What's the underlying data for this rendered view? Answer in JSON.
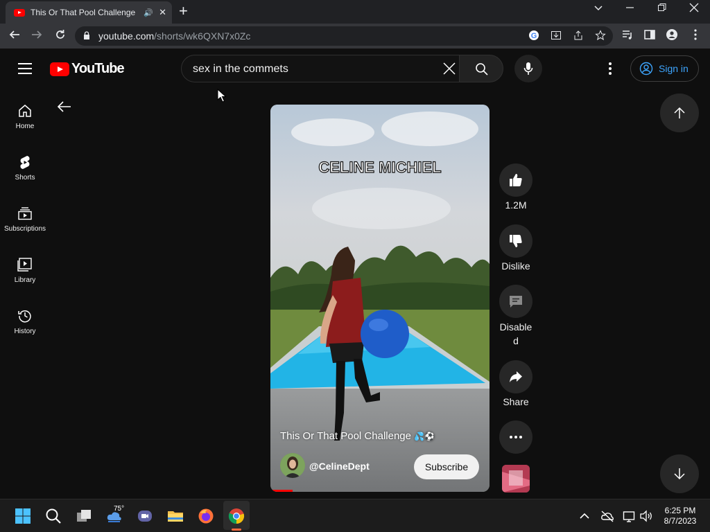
{
  "browser": {
    "tab_title": "This Or That Pool Challenge",
    "url_host": "youtube.com",
    "url_path": "/shorts/wk6QXN7x0Zc"
  },
  "youtube": {
    "logo_text": "YouTube",
    "search_value": "sex in the commets",
    "sign_in_label": "Sign in",
    "sidebar": [
      {
        "label": "Home",
        "icon": "home-icon"
      },
      {
        "label": "Shorts",
        "icon": "shorts-icon"
      },
      {
        "label": "Subscriptions",
        "icon": "subscriptions-icon"
      },
      {
        "label": "Library",
        "icon": "library-icon"
      },
      {
        "label": "History",
        "icon": "history-icon"
      }
    ],
    "short": {
      "overlay_text": "CELINE   MICHIEL",
      "title": "This Or That Pool Challenge",
      "channel": "@CelineDept",
      "subscribe_label": "Subscribe",
      "progress": 0.1
    },
    "actions": {
      "likes": "1.2M",
      "dislike_label": "Dislike",
      "comments_label_line1": "Disable",
      "comments_label_line2": "d",
      "share_label": "Share"
    }
  },
  "taskbar": {
    "weather_temp": "75°",
    "time": "6:25 PM",
    "date": "8/7/2023"
  },
  "colors": {
    "accent_red": "#ff0000",
    "link_blue": "#3ea6ff",
    "background": "#0f0f0f"
  }
}
